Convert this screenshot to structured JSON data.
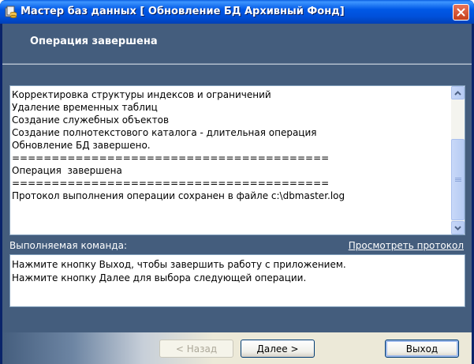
{
  "window": {
    "title": "Мастер баз данных [ Обновление БД Архивный Фонд]"
  },
  "header": {
    "title": "Операция завершена"
  },
  "log": {
    "lines": [
      "Корректировка структуры индексов и ограничений",
      "Удаление временных таблиц",
      "Создание служебных объектов",
      "Создание полнотекстового каталога - длительная операция",
      "Обновление БД завершено.",
      "========================================",
      "Операция  завершена",
      "========================================",
      "Протокол выполнения операции сохранен в файле c:\\dbmaster.log"
    ]
  },
  "command": {
    "label": "Выполняемая команда:",
    "link": "Просмотреть протокол",
    "lines": [
      "Нажмите кнопку Выход, чтобы завершить работу с приложением.",
      "Нажмите кнопку Далее для выбора следующей операции."
    ]
  },
  "buttons": {
    "back": "< Назад",
    "next": "Далее >",
    "exit": "Выход"
  },
  "colors": {
    "titlebar": "#0058e6",
    "client_background": "#445d7d",
    "footer": "#ece9d8"
  },
  "icons": {
    "app": "database-wizard-icon",
    "close": "close-icon",
    "scroll_up": "arrow-up-icon",
    "scroll_down": "arrow-down-icon"
  }
}
